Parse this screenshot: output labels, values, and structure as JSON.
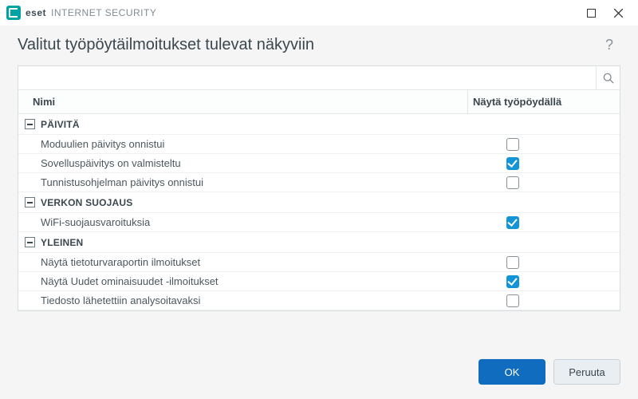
{
  "brand": {
    "main": "eset",
    "sub": "INTERNET SECURITY"
  },
  "window": {
    "maximize_name": "maximize-icon",
    "close_name": "close-icon"
  },
  "heading": "Valitut työpöytäilmoitukset tulevat näkyviin",
  "search": {
    "placeholder": ""
  },
  "columns": {
    "name": "Nimi",
    "show": "Näytä työpöydällä"
  },
  "groups": [
    {
      "label": "PÄIVITÄ",
      "rows": [
        {
          "label": "Moduulien päivitys onnistui",
          "checked": false
        },
        {
          "label": "Sovelluspäivitys on valmisteltu",
          "checked": true
        },
        {
          "label": "Tunnistusohjelman päivitys onnistui",
          "checked": false
        }
      ]
    },
    {
      "label": "VERKON SUOJAUS",
      "rows": [
        {
          "label": "WiFi-suojausvaroituksia",
          "checked": true
        }
      ]
    },
    {
      "label": "YLEINEN",
      "rows": [
        {
          "label": "Näytä tietoturvaraportin ilmoitukset",
          "checked": false
        },
        {
          "label": "Näytä Uudet ominaisuudet -ilmoitukset",
          "checked": true
        },
        {
          "label": "Tiedosto lähetettiin analysoitavaksi",
          "checked": false
        }
      ]
    }
  ],
  "buttons": {
    "ok": "OK",
    "cancel": "Peruuta"
  },
  "colors": {
    "accent": "#1195d7",
    "primary_btn": "#0f6cbf"
  }
}
